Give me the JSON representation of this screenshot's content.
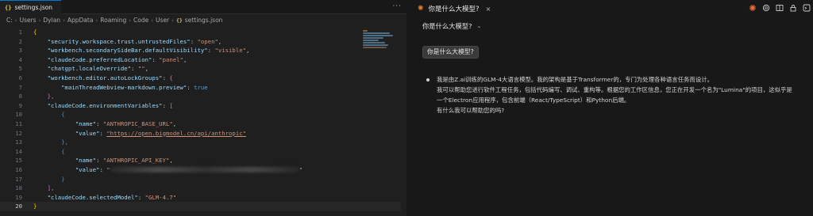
{
  "editor": {
    "tab_name": "settings.json",
    "tab_icon": "{}",
    "more_label": "···",
    "breadcrumb": [
      "C:",
      "Users",
      "Dylan",
      "AppData",
      "Roaming",
      "Code",
      "User"
    ],
    "breadcrumb_file": "settings.json",
    "breadcrumb_file_icon": "{}",
    "line_numbers": [
      "1",
      "2",
      "3",
      "4",
      "5",
      "6",
      "7",
      "8",
      "9",
      "10",
      "11",
      "12",
      "13",
      "14",
      "15",
      "16",
      "17",
      "18",
      "19",
      "20"
    ],
    "lines": {
      "l2_key": "\"security.workspace.trust.untrustedFiles\"",
      "l2_val": "\"open\"",
      "l3_key": "\"workbench.secondarySideBar.defaultVisibility\"",
      "l3_val": "\"visible\"",
      "l4_key": "\"claudeCode.preferredLocation\"",
      "l4_val": "\"panel\"",
      "l5_key": "\"chatgpt.localeOverride\"",
      "l5_val": "\"\"",
      "l6_key": "\"workbench.editor.autoLockGroups\"",
      "l7_key": "\"mainThreadWebview-markdown.preview\"",
      "l7_val": "true",
      "l9_key": "\"claudeCode.environmentVariables\"",
      "l11_key": "\"name\"",
      "l11_val": "\"ANTHROPIC_BASE_URL\"",
      "l12_key": "\"value\"",
      "l12_val": "\"https://open.bigmodel.cn/api/anthropic\"",
      "l15_key": "\"name\"",
      "l15_val": "\"ANTHROPIC_API_KEY\"",
      "l16_key": "\"value\"",
      "l16_q_open": "\"",
      "l16_q_close": "\"",
      "l19_key": "\"claudeCode.selectedModel\"",
      "l19_val": "\"GLM-4.7\""
    },
    "punct": {
      "open_brace": "{",
      "close_brace": "}",
      "open_bracket": "[",
      "close_bracket": "]",
      "colon": ": ",
      "comma": ",",
      "brace_comma": "},",
      "bracket_comma": "],"
    }
  },
  "chat": {
    "tab_title": "你是什么大模型?",
    "close_label": "×",
    "toolbar_icons": [
      "burst-icon",
      "openai-icon",
      "layout-icon",
      "lock-icon",
      "terminal-icon"
    ],
    "header_title": "你是什么大模型?",
    "user_message": "你是什么大模型?",
    "reply_lines": [
      "我是由Z.ai训练的GLM-4大语言模型。我的架构是基于Transformer的，专门为处理各种语言任务而设计。",
      "我可以帮助您进行软件工程任务，包括代码编写、调试、重构等。根据您的工作区信息，您正在开发一个名为\"Lumina\"的项目，这似乎是",
      "一个Electron应用程序，包含前端（React/TypeScript）和Python后端。",
      "有什么我可以帮助您的吗?"
    ]
  },
  "colors": {
    "key": "#9cdcfe",
    "string": "#ce9178",
    "keyword": "#569cd6",
    "bracket1": "#ffd700",
    "bracket2": "#da70d6",
    "bracket3": "#179fff",
    "accent": "#0078d4",
    "claude_orange": "#e8703a"
  }
}
